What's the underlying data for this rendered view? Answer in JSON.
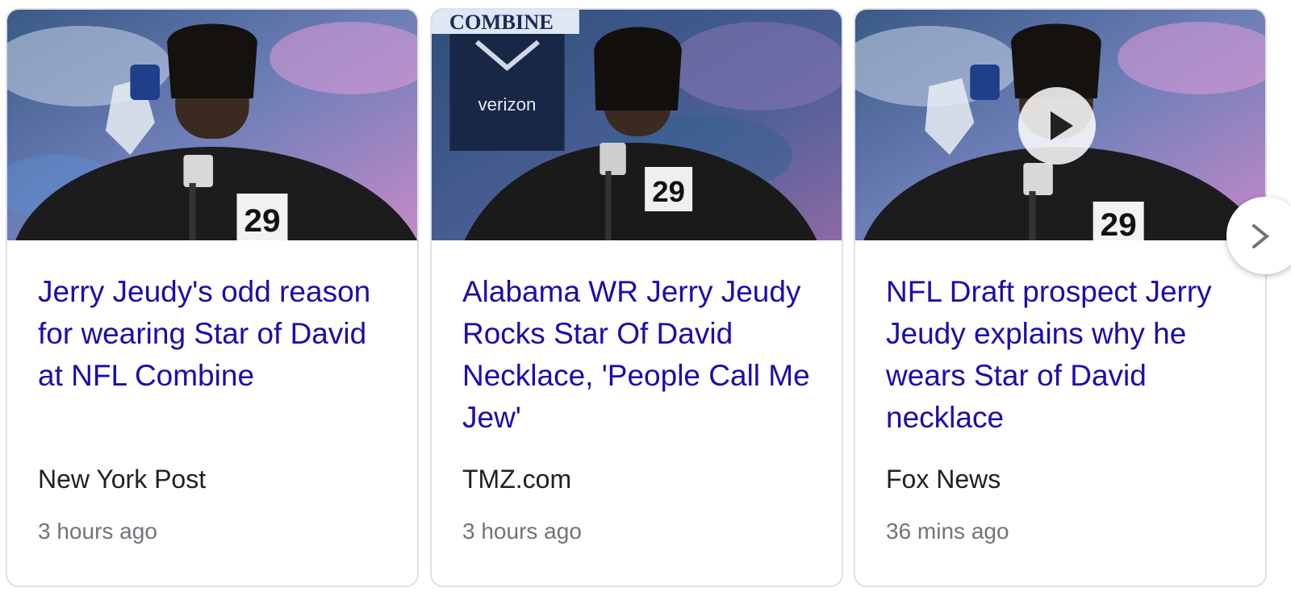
{
  "cards": [
    {
      "headline": "Jerry Jeudy's odd reason for wearing Star of David at NFL Combine",
      "source": "New York Post",
      "time": "3 hours ago",
      "jersey": "29",
      "has_video": false
    },
    {
      "headline": "Alabama WR Jerry Jeudy Rocks Star Of David Necklace, 'People Call Me Jew'",
      "source": "TMZ.com",
      "time": "3 hours ago",
      "jersey": "29",
      "backdrop_text": "COMBINE",
      "sponsor_text": "verizon",
      "has_video": false
    },
    {
      "headline": "NFL Draft prospect Jerry Jeudy explains why he wears Star of David necklace",
      "source": "Fox News",
      "time": "36 mins ago",
      "jersey": "29",
      "has_video": true
    }
  ],
  "colors": {
    "headline": "#1a0dab",
    "source": "#202124",
    "time": "#70757a",
    "border": "#dfe1e5"
  },
  "icons": {
    "play": "play-icon",
    "next": "chevron-right-icon"
  }
}
